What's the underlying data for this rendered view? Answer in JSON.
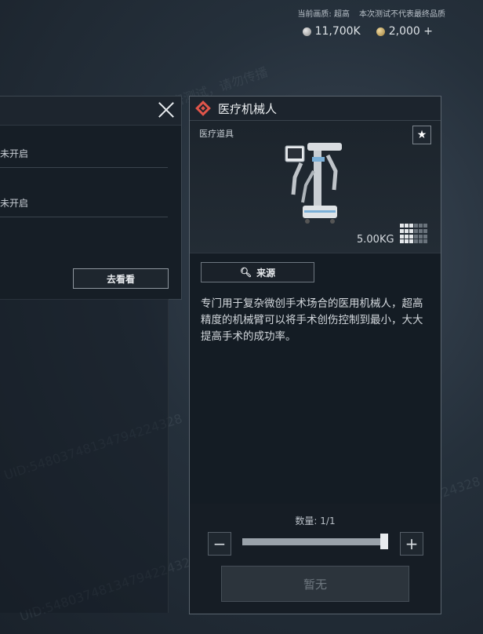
{
  "hud": {
    "quality_label": "当前画质:",
    "quality_value": "超高",
    "test_notice": "本次测试不代表最终品质",
    "currency": [
      {
        "icon": "silver-coin-icon",
        "value": "11,700K"
      },
      {
        "icon": "gold-coin-icon",
        "value": "2,000 +"
      }
    ]
  },
  "left_panel": {
    "rows": [
      {
        "label": "未开启"
      },
      {
        "label": "未开启"
      }
    ],
    "go_button": "去看看"
  },
  "item": {
    "title": "医疗机械人",
    "category": "医疗道具",
    "weight": "5.00KG",
    "source_button": "来源",
    "description": "专门用于复杂微创手术场合的医用机械人，超高精度的机械臂可以将手术创伤控制到最小，大大提高手术的成功率。",
    "accent_color": "#e0554a"
  },
  "quantity": {
    "label": "数量: 1/1",
    "current": 1,
    "max": 1,
    "confirm_button": "暂无"
  },
  "watermark": {
    "line1": "保密测试，请勿传播",
    "line2": "UID:54803748134794224328"
  }
}
